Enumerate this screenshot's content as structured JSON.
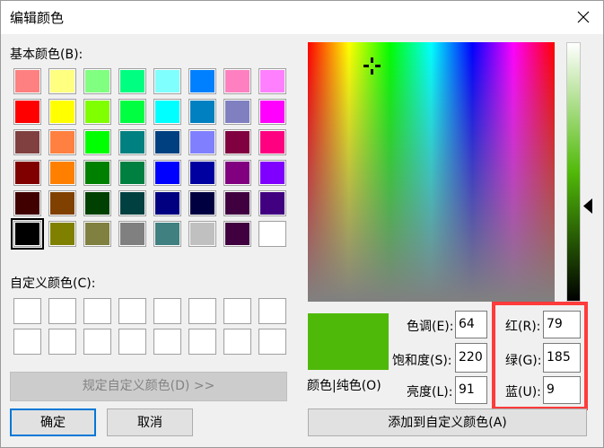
{
  "window": {
    "title": "编辑颜色"
  },
  "basic_colors_label": "基本颜色(B):",
  "custom_colors_label": "自定义颜色(C):",
  "basic_colors": [
    "#ff8080",
    "#ffff80",
    "#80ff80",
    "#00ff80",
    "#80ffff",
    "#0080ff",
    "#ff80c0",
    "#ff80ff",
    "#ff0000",
    "#ffff00",
    "#80ff00",
    "#00ff40",
    "#00ffff",
    "#0080c0",
    "#8080c0",
    "#ff00ff",
    "#804040",
    "#ff8040",
    "#00ff00",
    "#008080",
    "#004080",
    "#8080ff",
    "#800040",
    "#ff0080",
    "#800000",
    "#ff8000",
    "#008000",
    "#008040",
    "#0000ff",
    "#0000a0",
    "#800080",
    "#8000ff",
    "#400000",
    "#804000",
    "#004000",
    "#004040",
    "#000080",
    "#000040",
    "#400040",
    "#400080",
    "#000000",
    "#808000",
    "#808040",
    "#808080",
    "#408080",
    "#c0c0c0",
    "#400040",
    "#ffffff"
  ],
  "buttons": {
    "define_custom": "规定自定义颜色(D) >>",
    "ok": "确定",
    "cancel": "取消",
    "add_custom": "添加到自定义颜色(A)"
  },
  "preview_label": "颜色|纯色(O)",
  "hsl": {
    "hue_label": "色调(E):",
    "hue": "64",
    "sat_label": "饱和度(S):",
    "sat": "220",
    "lum_label": "亮度(L):",
    "lum": "91"
  },
  "rgb": {
    "red_label": "红(R):",
    "red": "79",
    "green_label": "绿(G):",
    "green": "185",
    "blue_label": "蓝(U):",
    "blue": "9"
  },
  "current_color": "#4fb909",
  "highlight_color": "#ff3b3b"
}
